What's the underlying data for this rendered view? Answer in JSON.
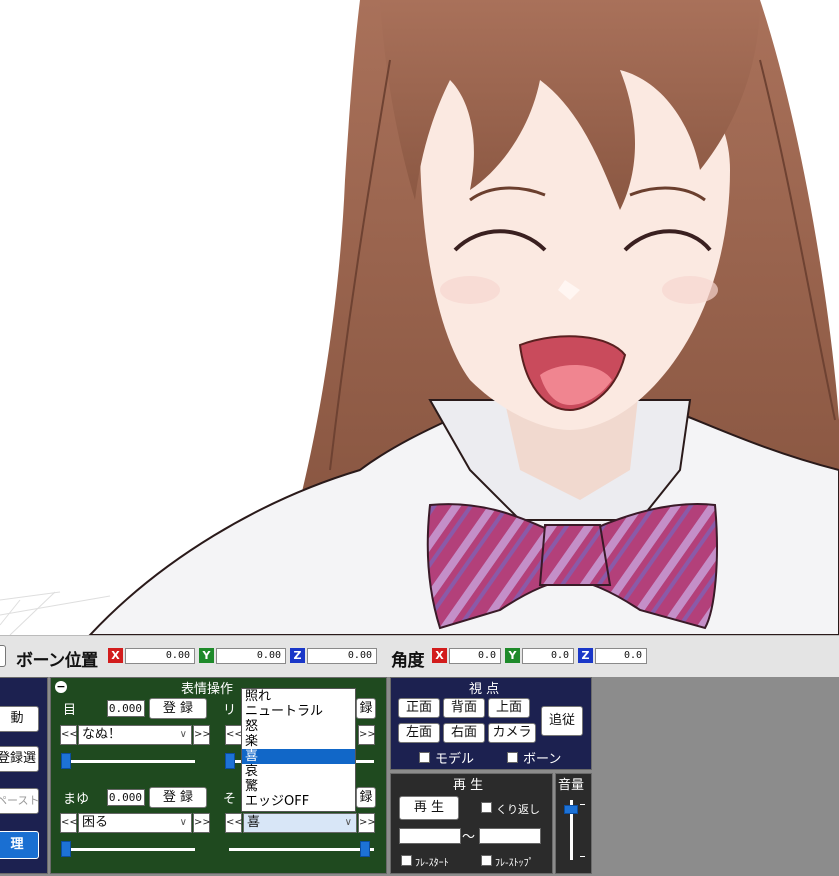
{
  "bone_bar": {
    "position_label": "ボーン位置",
    "angle_label": "角度",
    "pos": {
      "x_label": "X",
      "x": "0.00",
      "y_label": "Y",
      "y": "0.00",
      "z_label": "Z",
      "z": "0.00"
    },
    "ang": {
      "x_label": "X",
      "x": "0.0",
      "y_label": "Y",
      "y": "0.0",
      "z_label": "Z",
      "z": "0.0"
    },
    "axis_colors": {
      "x": "#d21c1c",
      "y": "#1e8a2a",
      "z": "#1a37c8"
    }
  },
  "left_panel": {
    "btn1": "動",
    "btn2": "登録選",
    "btn3": "ペースト",
    "btn4": "理"
  },
  "expression": {
    "title": "表情操作",
    "collapse_glyph": "−",
    "eye": {
      "label": "目",
      "value": "0.000",
      "register": "登 録",
      "selected": "なぬ！",
      "prev": "<<",
      "next": ">>",
      "slider": 0.0
    },
    "lip": {
      "label": "リ",
      "selected": "喜",
      "register": "録",
      "prev": "<<",
      "next": ">>",
      "slider": 0.0
    },
    "brow": {
      "label": "まゆ",
      "value": "0.000",
      "register": "登 録",
      "selected": "困る",
      "prev": "<<",
      "next": ">>",
      "slider": 0.0
    },
    "other": {
      "label": "そ",
      "register": "録",
      "selected": "喜",
      "prev": "<<",
      "next": ">>",
      "slider": 1.0
    },
    "dropdown_options": [
      "照れ",
      "ニュートラル",
      "怒",
      "楽",
      "喜",
      "哀",
      "驚",
      "エッジOFF"
    ],
    "dropdown_highlighted": "喜"
  },
  "viewpoint": {
    "title": "視 点",
    "front": "正面",
    "back": "背面",
    "top": "上面",
    "left": "左面",
    "right": "右面",
    "camera": "カメラ",
    "follow": "追従",
    "model_cb": "モデル",
    "bone_cb": "ボーン"
  },
  "playback": {
    "title": "再 生",
    "play": "再 生",
    "repeat": "くり返し",
    "tilde": "〜",
    "frame_start_cb": "ﾌﾚ-ｽﾀｰﾄ",
    "frame_stop_cb": "ﾌﾚ-ｽﾄｯﾌﾟ"
  },
  "volume": {
    "title": "音量",
    "level": 0.9
  }
}
